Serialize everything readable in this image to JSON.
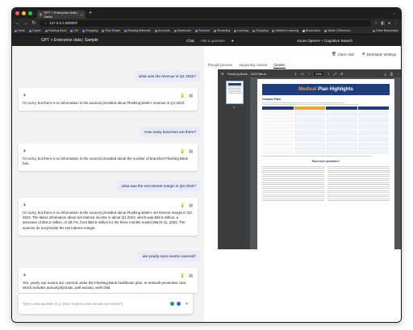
{
  "browser": {
    "tab_title": "GPT + Enterprise data | Samp",
    "url": "127.0.0.1:5000/#/",
    "bookmarks": [
      "News",
      "Crypto",
      "Flushing Bank",
      "Life",
      "Shopping",
      "Real Estate",
      "Reading Materials",
      "Accounts",
      "Healthcare",
      "Services",
      "Streaming",
      "Learning",
      "Shopping",
      "Machine Learning",
      "Bookmarks",
      "Vaults | Ethereum..."
    ],
    "other_bookmarks": "Other Bookmarks"
  },
  "app": {
    "title": "GPT + Enterprise data | Sample",
    "nav_chat": "Chat",
    "nav_ask": "Ask a question",
    "right_label": "Azure OpenAI + Cognitive Search"
  },
  "chat": {
    "messages": [
      {
        "role": "user",
        "text": "what was the revenue in Q1 2022?"
      },
      {
        "role": "assistant",
        "text": "I'm sorry, but there is no information in the sources provided about Flushing Bank's revenue in Q1 2022."
      },
      {
        "role": "user",
        "text": "How many branches are there?"
      },
      {
        "role": "assistant",
        "text": "I'm sorry, but there is no information in the sources provided about the number of branches Flushing Bank has."
      },
      {
        "role": "user",
        "text": "what was the net interest margin in Q3 2022?"
      },
      {
        "role": "assistant",
        "text": "I'm sorry, but there is no information in the sources provided about Flushing Bank's net interest margin in Q3 2022. The latest information about net interest income is about Q1 2023, which was $45.5 million, a decrease of $18.2 million, or 28.7%, from $63.5 million for the three months ended March 31, 2022. The sources do not provide the net interest margin."
      },
      {
        "role": "user",
        "text": "are yearly eyes exams covered?"
      },
      {
        "role": "assistant",
        "text": "Yes, yearly eye exams are covered under the Flushing Bank healthcare plan. In-network preventive care, which includes annual physicals, well-woman, well-child"
      }
    ],
    "composer_placeholder": "Type a new question (e.g. does my plan cover annual eye exams?)"
  },
  "panel": {
    "clear_chat": "Clear chat",
    "dev_settings": "Developer settings",
    "tabs": [
      "Thought process",
      "Supporting content",
      "Citation"
    ],
    "active_tab": "Citation"
  },
  "pdf": {
    "title": "Flushing Bank - 2023 Bene...",
    "page": "1",
    "total": "/ 1",
    "zoom": "94%",
    "thumb_number": "1",
    "banner_accent": "Medical",
    "banner_rest": "Plan Highlights",
    "section_title": "Compare Plans",
    "qa_title": "Have more questions?"
  },
  "colors": {
    "accent": "#6b5cd6",
    "user_bubble": "#e8ebfa",
    "pdf_navy": "#1f3d7a",
    "pdf_orange": "#f0a23a"
  }
}
